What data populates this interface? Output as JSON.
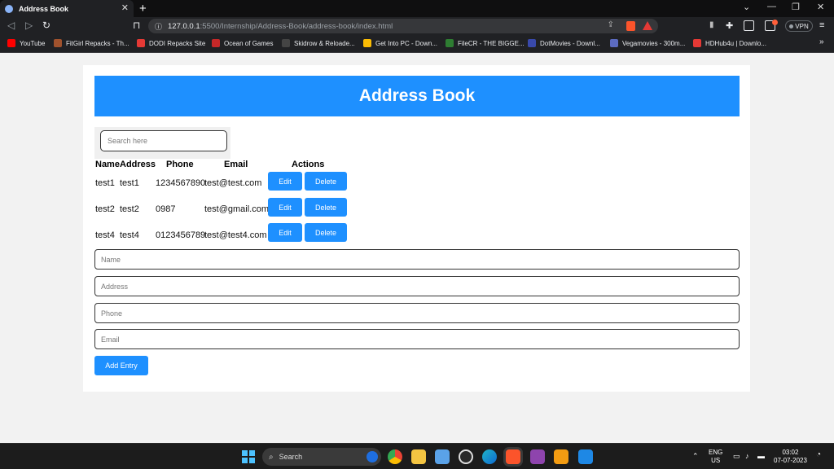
{
  "browser": {
    "tab_title": "Address Book",
    "tab_close": "✕",
    "new_tab": "+",
    "url_host": "127.0.0.1",
    "url_path": ":5500/Internship/Address-Book/address-book/index.html",
    "vpn_label": "VPN",
    "bookmarks": [
      {
        "label": "YouTube",
        "color": "#ff0000"
      },
      {
        "label": "FitGirl Repacks - Th...",
        "color": "#a0522d"
      },
      {
        "label": "DODI Repacks Site",
        "color": "#e53935"
      },
      {
        "label": "Ocean of Games",
        "color": "#c62828"
      },
      {
        "label": "Skidrow & Reloade...",
        "color": "#444444"
      },
      {
        "label": "Get Into PC - Down...",
        "color": "#fbbc04"
      },
      {
        "label": "FileCR - THE BIGGE...",
        "color": "#2e7d32"
      },
      {
        "label": "DotMovies - Downl...",
        "color": "#3949ab"
      },
      {
        "label": "Vegamovies - 300m...",
        "color": "#5c6bc0"
      },
      {
        "label": "HDHub4u | Downlo...",
        "color": "#e53935"
      }
    ],
    "bookmarks_more": "»"
  },
  "app": {
    "title": "Address Book",
    "search_placeholder": "Search here",
    "columns": [
      "Name",
      "Address",
      "Phone",
      "Email",
      "Actions"
    ],
    "rows": [
      {
        "name": "test1",
        "address": "test1",
        "phone": "1234567890",
        "email": "test@test.com"
      },
      {
        "name": "test2",
        "address": "test2",
        "phone": "0987",
        "email": "test@gmail.com"
      },
      {
        "name": "test4",
        "address": "test4",
        "phone": "0123456789",
        "email": "test@test4.com"
      }
    ],
    "edit_label": "Edit",
    "delete_label": "Delete",
    "fields": {
      "name_placeholder": "Name",
      "address_placeholder": "Address",
      "phone_placeholder": "Phone",
      "email_placeholder": "Email"
    },
    "add_button": "Add Entry",
    "accent": "#1e90ff"
  },
  "taskbar": {
    "search_label": "Search",
    "lang_top": "ENG",
    "lang_bottom": "US",
    "time": "03:02",
    "date": "07-07-2023"
  }
}
